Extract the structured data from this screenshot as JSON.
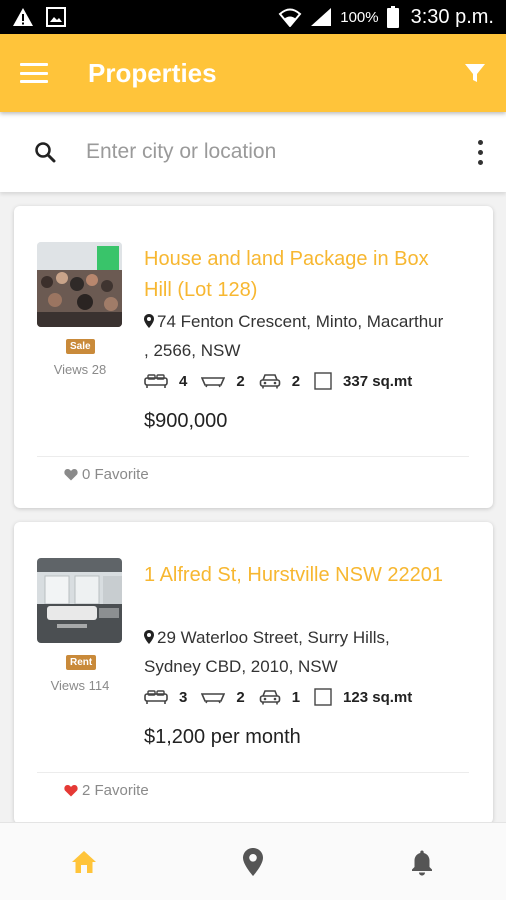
{
  "status_bar": {
    "battery": "100%",
    "time": "3:30 p.m.",
    "icons": [
      "warning-icon",
      "image-icon",
      "wifi-icon",
      "signal-icon",
      "battery-icon"
    ]
  },
  "app_bar": {
    "title": "Properties",
    "background_color": "#ffc43a",
    "icons": [
      "menu-icon",
      "filter-icon"
    ]
  },
  "search": {
    "placeholder": "Enter city or location",
    "value": "",
    "icons": [
      "search-icon",
      "more-vert-icon"
    ]
  },
  "listings": [
    {
      "title": "House and land Package in Box Hill (Lot 128)",
      "badge": "Sale",
      "views": "Views 28",
      "address": "74 Fenton Crescent, Minto, Macarthur , 2566, NSW",
      "beds": "4",
      "baths": "2",
      "cars": "2",
      "area": "337 sq.mt",
      "price": "$900,000",
      "favorites": "0 Favorite",
      "favorited": false
    },
    {
      "title": "1 Alfred St, Hurstville NSW 22201",
      "badge": "Rent",
      "views": "Views 114",
      "address": "29 Waterloo Street, Surry Hills, Sydney CBD, 2010, NSW",
      "beds": "3",
      "baths": "2",
      "cars": "1",
      "area": "123 sq.mt",
      "price": "$1,200 per month",
      "favorites": "2 Favorite",
      "favorited": true
    }
  ],
  "bottom_nav": {
    "items": [
      "home-icon",
      "location-pin-icon",
      "notification-bell-icon"
    ],
    "active": "home-icon",
    "active_color": "#ffc43a",
    "inactive_color": "#555555"
  },
  "colors": {
    "accent": "#ffc43a",
    "title": "#f7b731",
    "badge": "#c98a3a",
    "favorite_active": "#e53935"
  }
}
